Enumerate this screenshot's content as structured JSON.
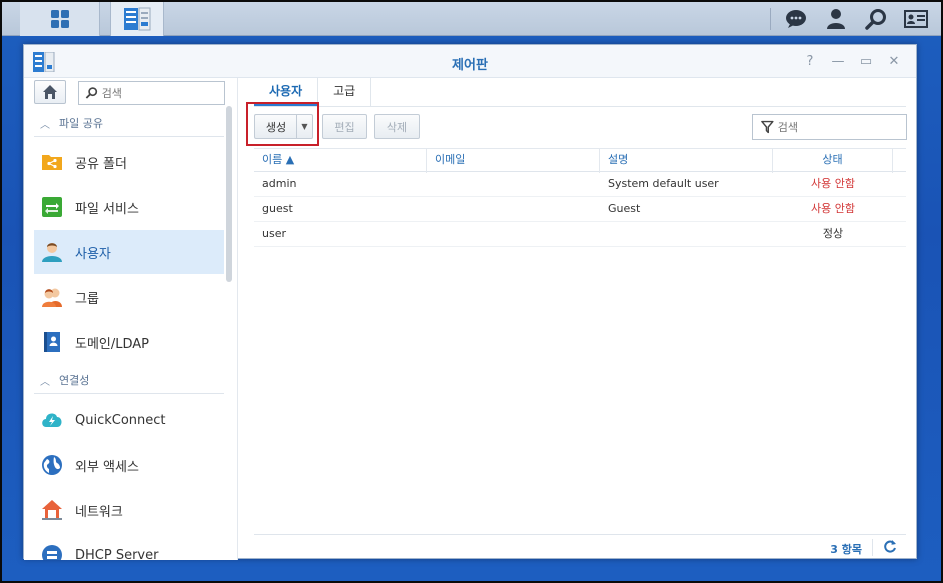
{
  "taskbar": {
    "main_menu_icon": "grid-icon",
    "app_icon": "control-panel-icon",
    "right_icons": [
      "chat-icon",
      "user-icon",
      "search-icon",
      "widget-icon"
    ]
  },
  "window": {
    "title": "제어판",
    "controls": [
      "?",
      "—",
      "▭",
      "✕"
    ]
  },
  "sidebar": {
    "search_placeholder": "검색",
    "categories": [
      {
        "label": "파일 공유"
      },
      {
        "label": "연결성"
      }
    ],
    "items": [
      {
        "label": "공유 폴더",
        "icon": "shared-folder-icon"
      },
      {
        "label": "파일 서비스",
        "icon": "file-services-icon"
      },
      {
        "label": "사용자",
        "icon": "user-icon",
        "active": true
      },
      {
        "label": "그룹",
        "icon": "group-icon"
      },
      {
        "label": "도메인/LDAP",
        "icon": "domain-ldap-icon"
      },
      {
        "label": "QuickConnect",
        "icon": "quickconnect-icon"
      },
      {
        "label": "외부 액세스",
        "icon": "external-access-icon"
      },
      {
        "label": "네트워크",
        "icon": "network-icon"
      },
      {
        "label": "DHCP Server",
        "icon": "dhcp-server-icon"
      }
    ]
  },
  "tabs": [
    {
      "label": "사용자",
      "active": true
    },
    {
      "label": "고급"
    }
  ],
  "toolbar": {
    "create_label": "생성",
    "create_dropdown": "▼",
    "edit_label": "편집",
    "delete_label": "삭제",
    "search_placeholder": "검색"
  },
  "grid": {
    "columns": [
      "이름 ▲",
      "이메일",
      "설명",
      "상태"
    ],
    "rows": [
      {
        "name": "admin",
        "email": "",
        "description": "System default user",
        "status": "사용 안함"
      },
      {
        "name": "guest",
        "email": "",
        "description": "Guest",
        "status": "사용 안함"
      },
      {
        "name": "user",
        "email": "",
        "description": "",
        "status": "정상"
      }
    ]
  },
  "footer": {
    "count": "3 항목"
  },
  "colors": {
    "accent": "#2a6fb5",
    "disabled_status": "#d23535",
    "active_item_bg": "#dcebfa",
    "highlight_box": "#c8202a"
  }
}
